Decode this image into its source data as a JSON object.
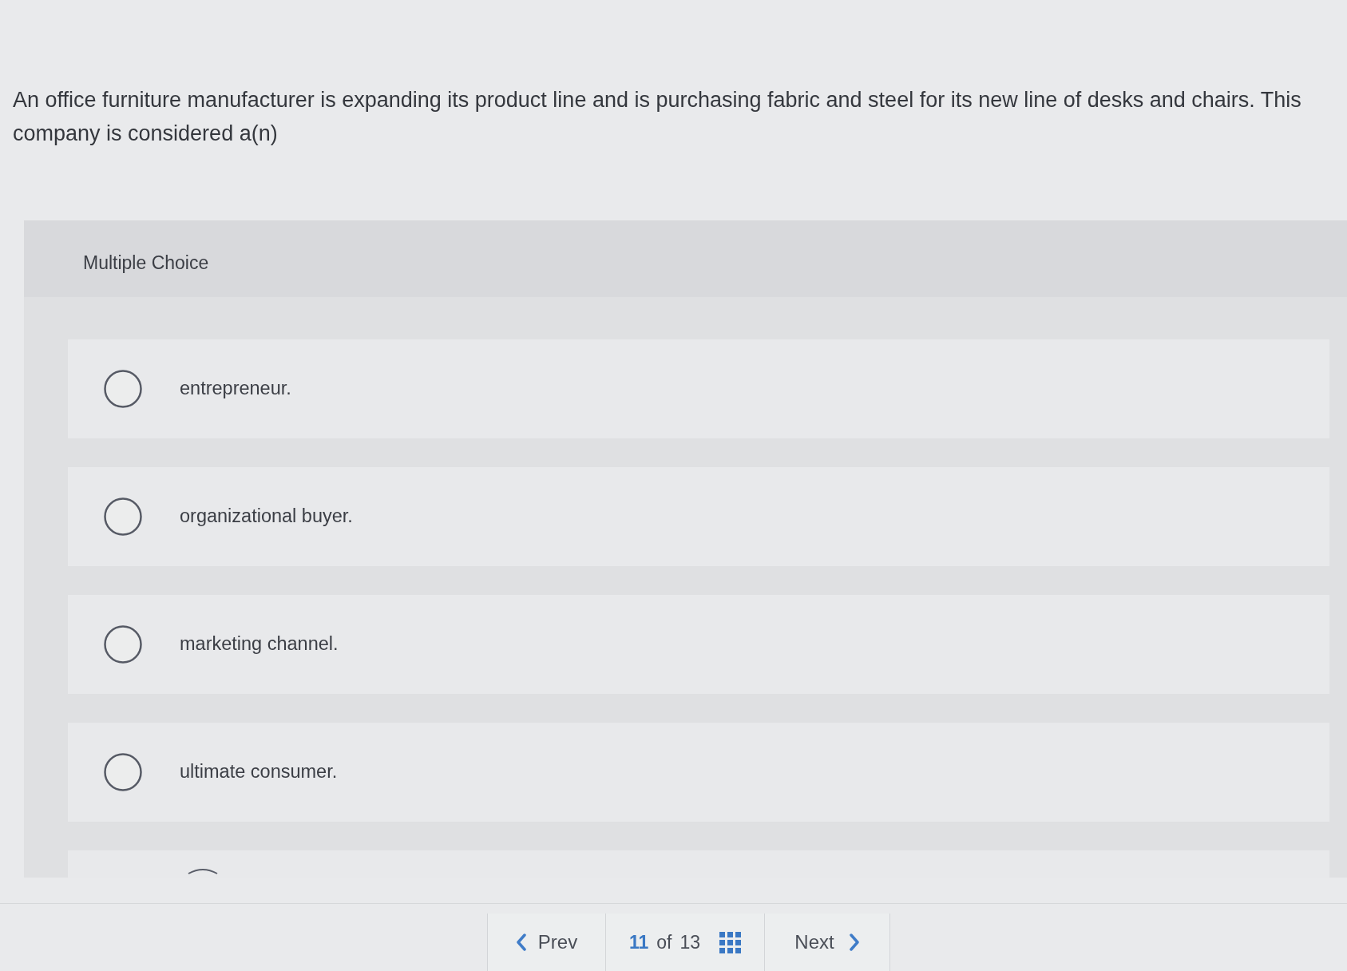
{
  "question": {
    "text": "An office furniture manufacturer is expanding its product line and is purchasing fabric and steel for its new line of desks and chairs. This company is considered a(n)"
  },
  "panel": {
    "title": "Multiple Choice"
  },
  "options": [
    {
      "label": "entrepreneur.",
      "selected": false
    },
    {
      "label": "organizational buyer.",
      "selected": false
    },
    {
      "label": "marketing channel.",
      "selected": false
    },
    {
      "label": "ultimate consumer.",
      "selected": false
    }
  ],
  "pagination": {
    "prev": "Prev",
    "current": "11",
    "of": "of",
    "total": "13",
    "next": "Next"
  }
}
